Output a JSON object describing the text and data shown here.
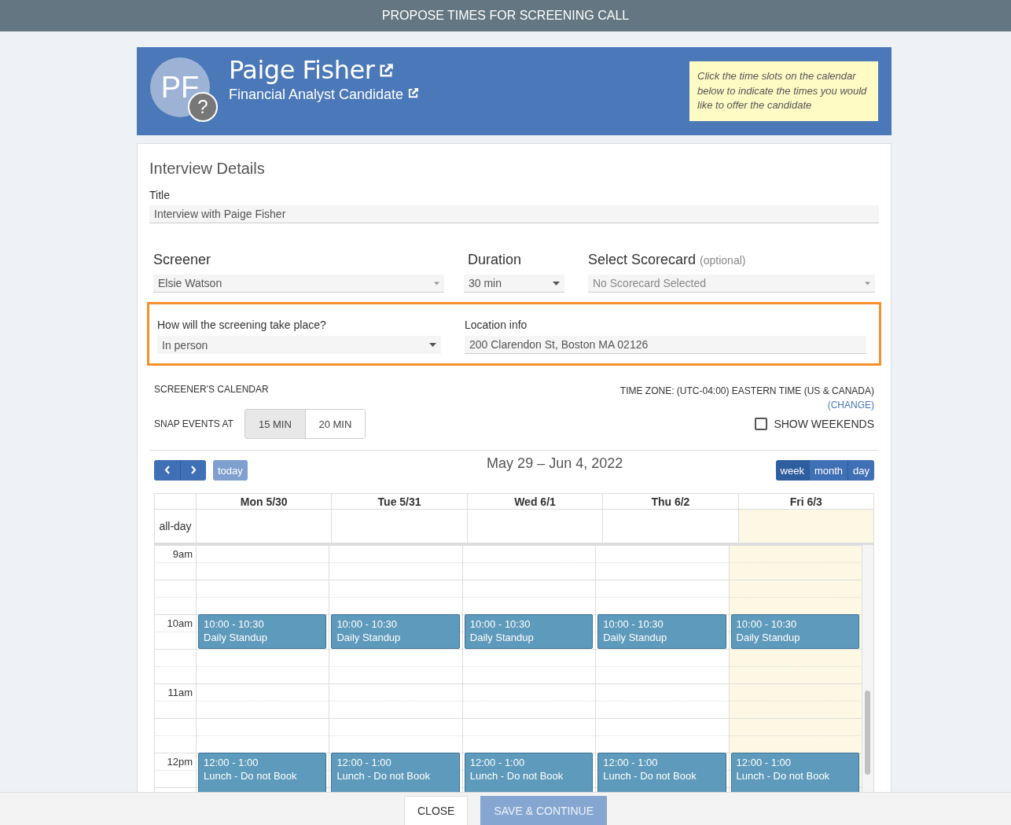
{
  "window": {
    "title": "PROPOSE TIMES FOR SCREENING CALL"
  },
  "candidate": {
    "initials": "PF",
    "badge": "?",
    "name": "Paige Fisher",
    "role": "Financial Analyst Candidate"
  },
  "hint": "Click the time slots on the calendar below to indicate the times you would like to offer the candidate",
  "details": {
    "heading": "Interview Details",
    "title_field": {
      "label": "Title",
      "value": "Interview with Paige Fisher"
    },
    "screener": {
      "label": "Screener",
      "value": "Elsie Watson"
    },
    "duration": {
      "label": "Duration",
      "value": "30 min"
    },
    "scorecard": {
      "label": "Select Scorecard",
      "note": "(optional)",
      "placeholder": "No Scorecard Selected"
    },
    "method": {
      "label": "How will the screening take place?",
      "value": "In person"
    },
    "location": {
      "label": "Location info",
      "value": "200 Clarendon St, Boston MA 02126"
    }
  },
  "calendar": {
    "label": "SCREENER'S CALENDAR",
    "timezone": "TIME ZONE: (UTC-04:00) EASTERN TIME (US & CANADA)",
    "change_link": "(CHANGE)",
    "snap_label": "SNAP EVENTS AT",
    "snap_options": [
      {
        "label": "15 MIN",
        "selected": true
      },
      {
        "label": "20 MIN",
        "selected": false
      }
    ],
    "show_weekends": {
      "label": "SHOW WEEKENDS",
      "checked": false
    },
    "range": "May 29 – Jun 4, 2022",
    "today_button": "today",
    "views": [
      {
        "label": "week",
        "selected": true
      },
      {
        "label": "month",
        "selected": false
      },
      {
        "label": "day",
        "selected": false
      }
    ],
    "allday_label": "all-day",
    "days": [
      {
        "label": "Mon 5/30",
        "today": false
      },
      {
        "label": "Tue 5/31",
        "today": false
      },
      {
        "label": "Wed 6/1",
        "today": false
      },
      {
        "label": "Thu 6/2",
        "today": false
      },
      {
        "label": "Fri 6/3",
        "today": true
      }
    ],
    "hours": [
      {
        "label": "9am"
      },
      {
        "label": "10am",
        "events": [
          {
            "kind": "half-hour",
            "time": "10:00 - 10:30",
            "title": "Daily Standup"
          },
          {
            "kind": "half-hour",
            "time": "10:00 - 10:30",
            "title": "Daily Standup"
          },
          {
            "kind": "half-hour",
            "time": "10:00 - 10:30",
            "title": "Daily Standup"
          },
          {
            "kind": "half-hour",
            "time": "10:00 - 10:30",
            "title": "Daily Standup"
          },
          {
            "kind": "half-hour",
            "time": "10:00 - 10:30",
            "title": "Daily Standup"
          }
        ]
      },
      {
        "label": "11am"
      },
      {
        "label": "12pm",
        "events": [
          {
            "kind": "hour",
            "time": "12:00 - 1:00",
            "title": "Lunch - Do not Book"
          },
          {
            "kind": "hour",
            "time": "12:00 - 1:00",
            "title": "Lunch - Do not Book"
          },
          {
            "kind": "hour",
            "time": "12:00 - 1:00",
            "title": "Lunch - Do not Book"
          },
          {
            "kind": "hour",
            "time": "12:00 - 1:00",
            "title": "Lunch - Do not Book"
          },
          {
            "kind": "hour",
            "time": "12:00 - 1:00",
            "title": "Lunch - Do not Book"
          }
        ]
      }
    ]
  },
  "footer": {
    "buttons": [
      {
        "kind": "secondary",
        "label": "CLOSE",
        "disabled": false
      },
      {
        "kind": "primary",
        "label": "SAVE & CONTINUE",
        "disabled": true
      }
    ]
  }
}
